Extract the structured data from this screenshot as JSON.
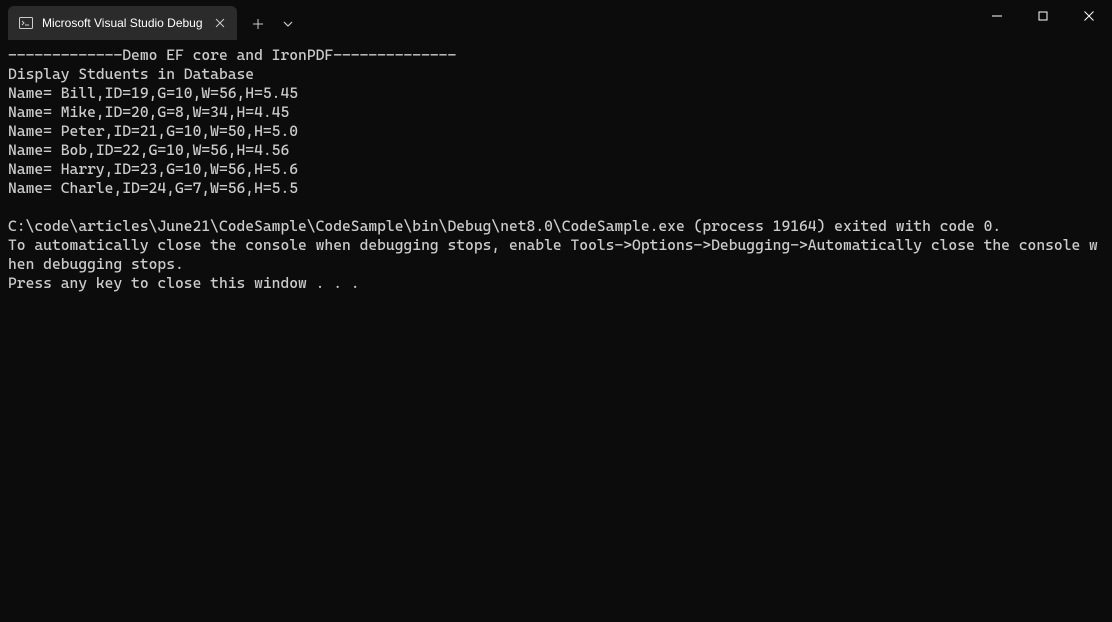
{
  "titlebar": {
    "tab_title": "Microsoft Visual Studio Debug",
    "tab_icon_name": "terminal-icon"
  },
  "terminal": {
    "lines": [
      "-------------Demo EF core and IronPDF--------------",
      "Display Stduents in Database",
      "Name= Bill,ID=19,G=10,W=56,H=5.45",
      "Name= Mike,ID=20,G=8,W=34,H=4.45",
      "Name= Peter,ID=21,G=10,W=50,H=5.0",
      "Name= Bob,ID=22,G=10,W=56,H=4.56",
      "Name= Harry,ID=23,G=10,W=56,H=5.6",
      "Name= Charle,ID=24,G=7,W=56,H=5.5",
      "",
      "C:\\code\\articles\\June21\\CodeSample\\CodeSample\\bin\\Debug\\net8.0\\CodeSample.exe (process 19164) exited with code 0.",
      "To automatically close the console when debugging stops, enable Tools->Options->Debugging->Automatically close the console when debugging stops.",
      "Press any key to close this window . . ."
    ]
  }
}
